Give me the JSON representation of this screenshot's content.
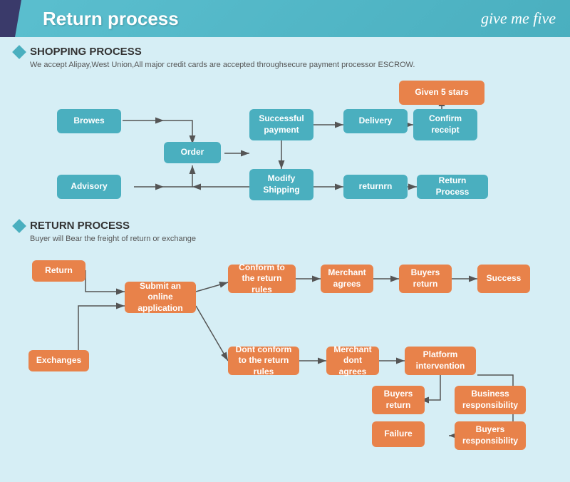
{
  "header": {
    "title": "Return process",
    "logo": "give me five"
  },
  "shopping": {
    "title": "SHOPPING PROCESS",
    "desc": "We accept Alipay,West Union,All major credit cards are accepted throughsecure payment processor ESCROW.",
    "boxes": {
      "browes": "Browes",
      "order": "Order",
      "advisory": "Advisory",
      "successful_payment": "Successful\npayment",
      "modify_shipping": "Modify\nShipping",
      "delivery": "Delivery",
      "confirm_receipt": "Confirm\nreceipt",
      "given_5_stars": "Given 5 stars",
      "returnrn": "returnrn",
      "return_process": "Return Process"
    }
  },
  "return": {
    "title": "RETURN PROCESS",
    "desc": "Buyer will Bear the freight of return or exchange",
    "boxes": {
      "return": "Return",
      "exchanges": "Exchanges",
      "submit_online": "Submit an online\napplication",
      "conform_rules": "Conform to the\nreturn rules",
      "dont_conform_rules": "Dont conform to the\nreturn rules",
      "merchant_agrees": "Merchant\nagrees",
      "merchant_dont_agrees": "Merchant\ndont agrees",
      "buyers_return1": "Buyers\nreturn",
      "platform_intervention": "Platform\nintervention",
      "success": "Success",
      "buyers_return2": "Buyers\nreturn",
      "business_responsibility": "Business\nresponsibility",
      "failure": "Failure",
      "buyers_responsibility": "Buyers\nresponsibility"
    }
  }
}
